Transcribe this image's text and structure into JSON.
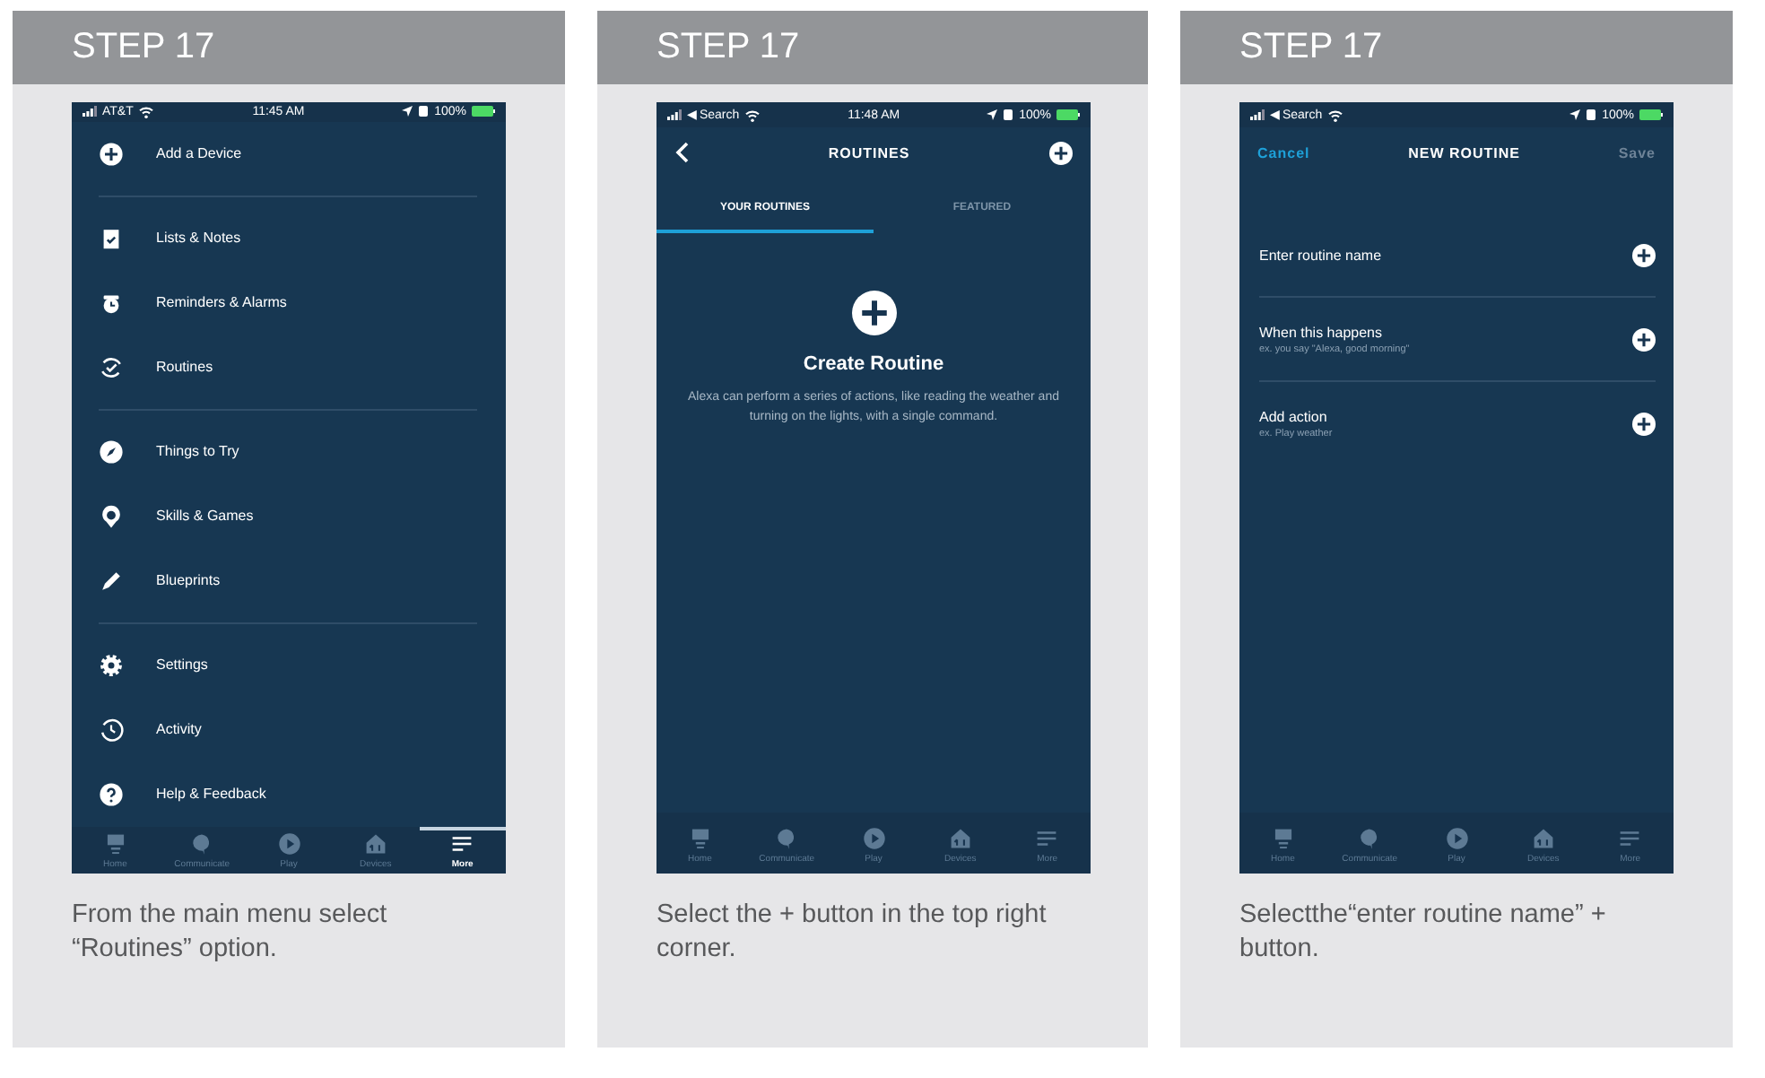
{
  "panels": [
    {
      "header": "STEP 17",
      "caption": "From the main menu select “Routines” option.",
      "screen": {
        "kind": "menu",
        "status": {
          "left": "AT&T",
          "time": "11:45 AM",
          "battery": "100%"
        },
        "groups": [
          [
            "Add a Device"
          ],
          [
            "Lists & Notes",
            "Reminders & Alarms",
            "Routines"
          ],
          [
            "Things to Try",
            "Skills & Games",
            "Blueprints"
          ],
          [
            "Settings",
            "Activity",
            "Help & Feedback"
          ]
        ],
        "tabbar": [
          {
            "label": "Home",
            "selected": false
          },
          {
            "label": "Communicate",
            "selected": false
          },
          {
            "label": "Play",
            "selected": false
          },
          {
            "label": "Devices",
            "selected": false
          },
          {
            "label": "More",
            "selected": true
          }
        ]
      }
    },
    {
      "header": "STEP 17",
      "caption": "Select the + button in the top right corner.",
      "screen": {
        "kind": "routines",
        "status": {
          "left": "◀ Search",
          "time": "11:48 AM",
          "battery": "100%"
        },
        "title": "ROUTINES",
        "tabs": [
          {
            "label": "YOUR ROUTINES",
            "selected": true
          },
          {
            "label": "FEATURED",
            "selected": false
          }
        ],
        "empty_title": "Create Routine",
        "empty_text": "Alexa can perform a series of actions, like reading the weather and turning on the lights, with a single command.",
        "tabbar": [
          {
            "label": "Home",
            "selected": false
          },
          {
            "label": "Communicate",
            "selected": false
          },
          {
            "label": "Play",
            "selected": false
          },
          {
            "label": "Devices",
            "selected": false
          },
          {
            "label": "More",
            "selected": false
          }
        ]
      }
    },
    {
      "header": "STEP 17",
      "caption": "Selectthe“enter routine name” + button.",
      "screen": {
        "kind": "new_routine",
        "status": {
          "left": "◀ Search",
          "battery": "100%"
        },
        "cancel": "Cancel",
        "title": "NEW ROUTINE",
        "save": "Save",
        "rows": [
          {
            "label": "Enter routine name"
          },
          {
            "label": "When this happens",
            "hint": "ex. you say \"Alexa, good morning\""
          },
          {
            "label": "Add action",
            "hint": "ex. Play weather"
          }
        ],
        "tabbar": [
          {
            "label": "Home",
            "selected": false
          },
          {
            "label": "Communicate",
            "selected": false
          },
          {
            "label": "Play",
            "selected": false
          },
          {
            "label": "Devices",
            "selected": false
          },
          {
            "label": "More",
            "selected": false
          }
        ]
      }
    }
  ]
}
